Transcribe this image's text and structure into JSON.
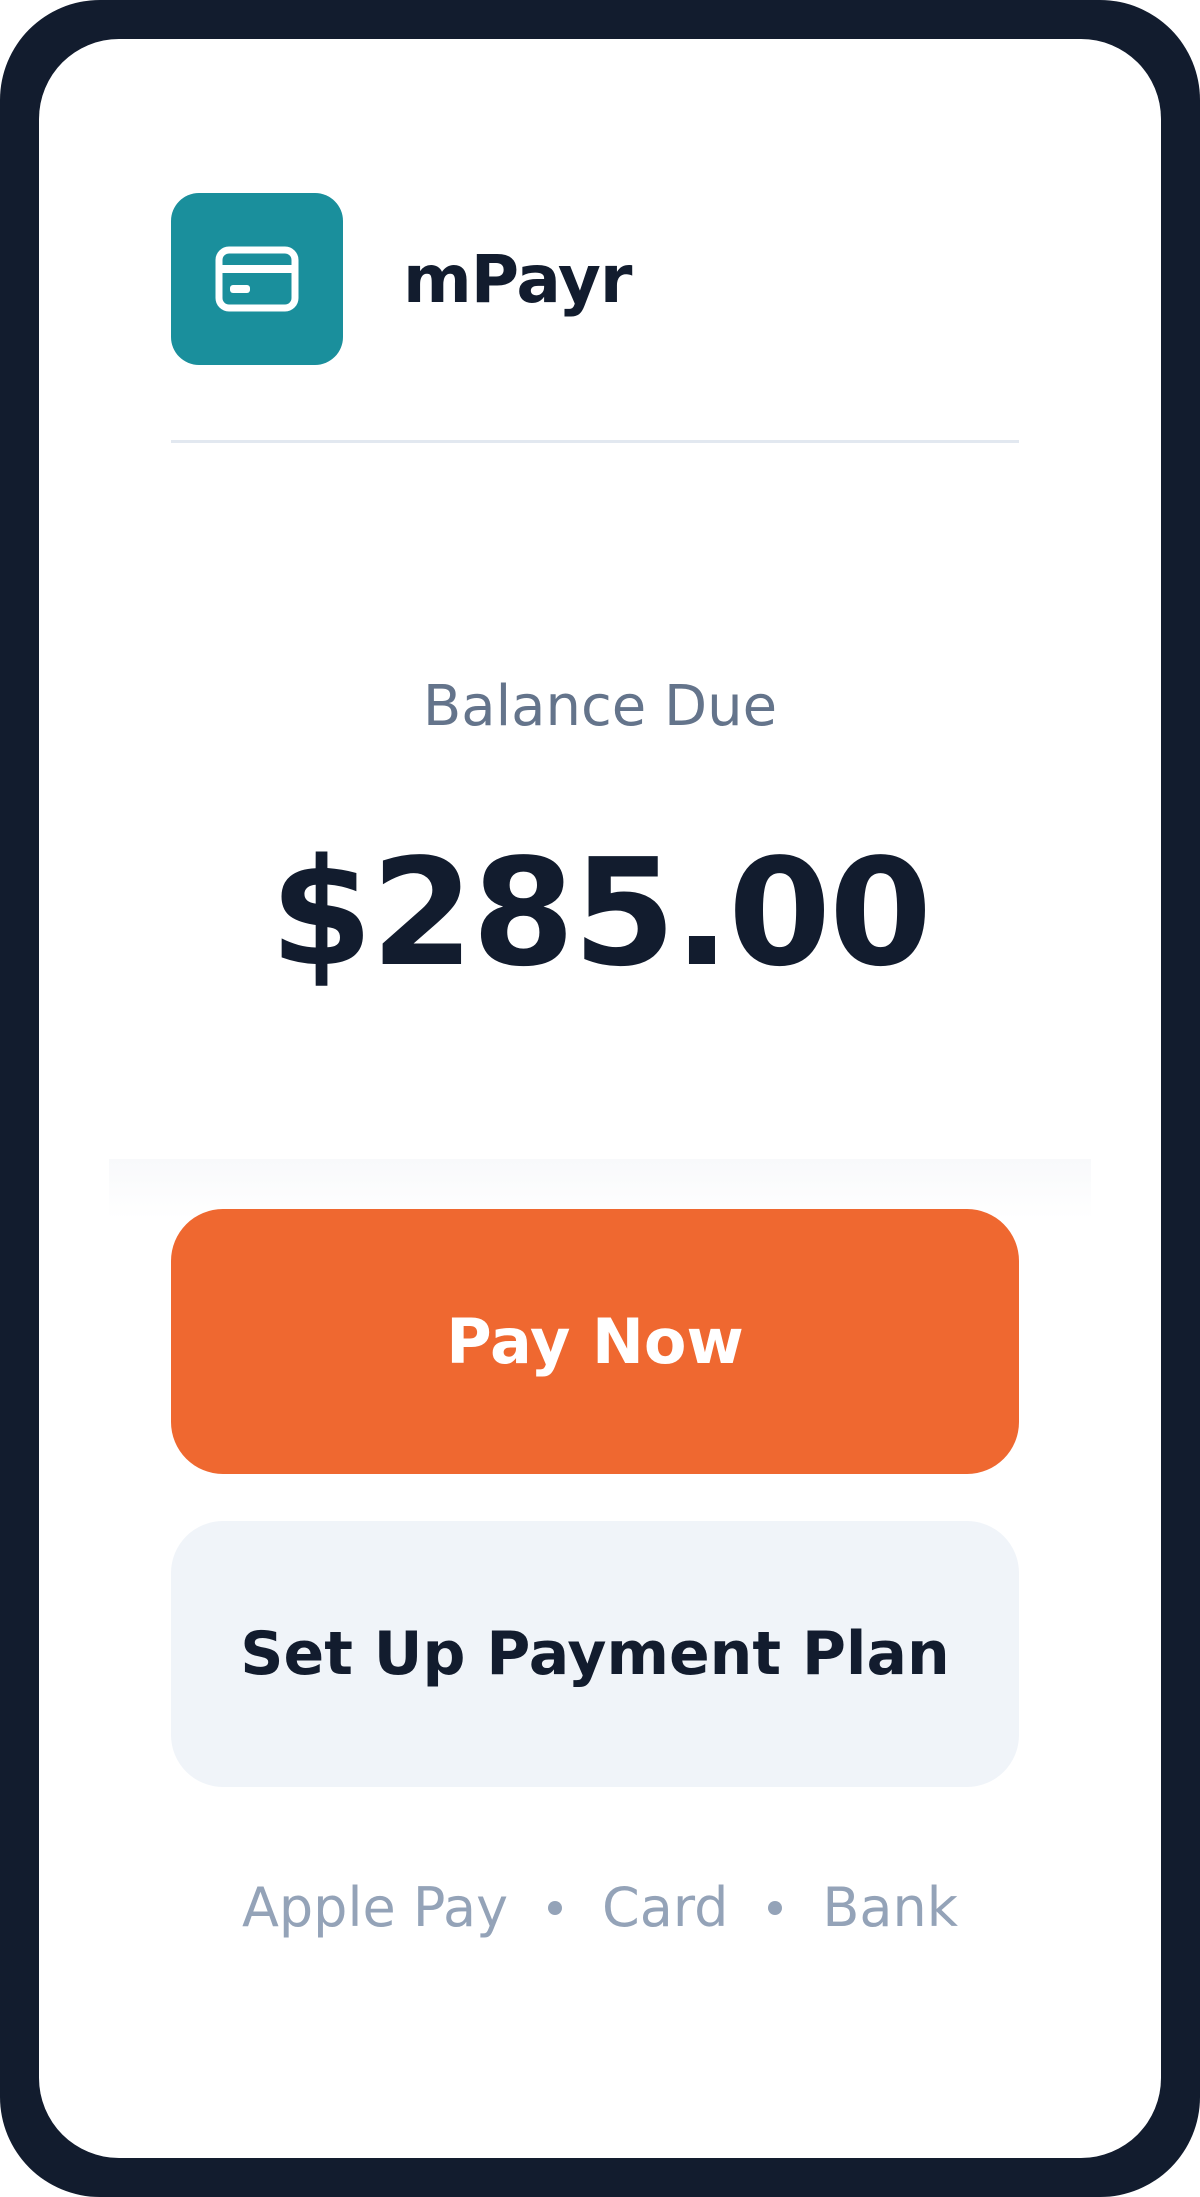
{
  "app": {
    "name": "mPayr",
    "logo_icon": "credit-card-icon",
    "brand_color": "#1a8f9c"
  },
  "balance": {
    "label": "Balance Due",
    "amount": "$285.00"
  },
  "actions": {
    "pay_now_label": "Pay Now",
    "pay_now_color": "#ef6830",
    "payment_plan_label": "Set Up Payment Plan"
  },
  "payment_methods": {
    "items": [
      "Apple Pay",
      "Card",
      "Bank"
    ]
  },
  "colors": {
    "frame": "#121c2e",
    "text_primary": "#121c2e",
    "text_muted": "#64748b",
    "text_subtle": "#94a3b8"
  }
}
